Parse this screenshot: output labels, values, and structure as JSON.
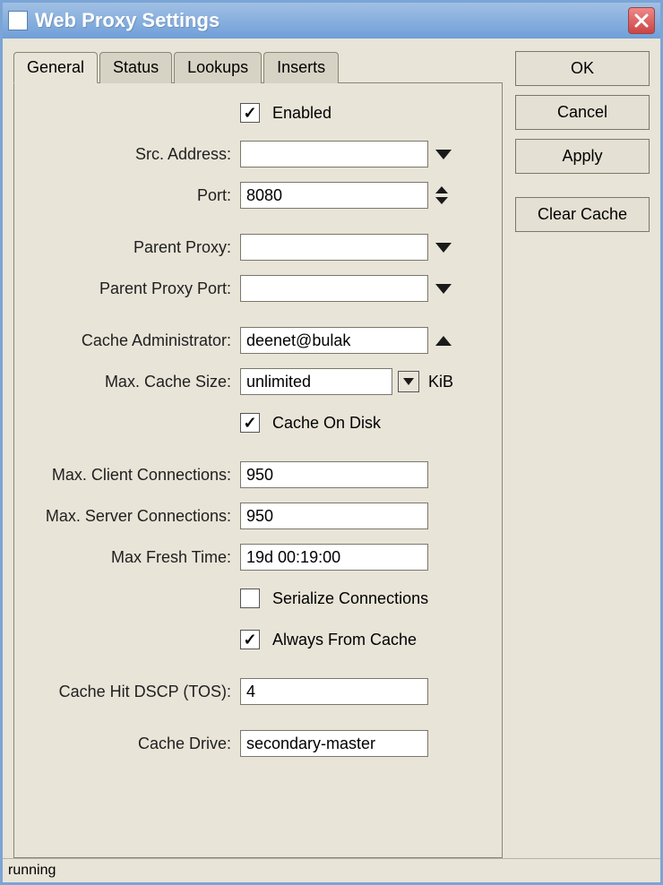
{
  "window": {
    "title": "Web Proxy Settings"
  },
  "tabs": {
    "general": "General",
    "status": "Status",
    "lookups": "Lookups",
    "inserts": "Inserts"
  },
  "labels": {
    "enabled": "Enabled",
    "src_address": "Src. Address:",
    "port": "Port:",
    "parent_proxy": "Parent Proxy:",
    "parent_proxy_port": "Parent Proxy Port:",
    "cache_admin": "Cache Administrator:",
    "max_cache_size": "Max. Cache Size:",
    "cache_on_disk": "Cache On Disk",
    "max_client_conn": "Max. Client Connections:",
    "max_server_conn": "Max. Server Connections:",
    "max_fresh_time": "Max Fresh Time:",
    "serialize_conn": "Serialize Connections",
    "always_from_cache": "Always From Cache",
    "cache_hit_dscp": "Cache Hit DSCP (TOS):",
    "cache_drive": "Cache Drive:",
    "kib": "KiB"
  },
  "values": {
    "enabled": true,
    "src_address": "",
    "port": "8080",
    "parent_proxy": "",
    "parent_proxy_port": "",
    "cache_admin": "deenet@bulak",
    "max_cache_size": "unlimited",
    "cache_on_disk": true,
    "max_client_conn": "950",
    "max_server_conn": "950",
    "max_fresh_time": "19d 00:19:00",
    "serialize_conn": false,
    "always_from_cache": true,
    "cache_hit_dscp": "4",
    "cache_drive": "secondary-master"
  },
  "buttons": {
    "ok": "OK",
    "cancel": "Cancel",
    "apply": "Apply",
    "clear_cache": "Clear Cache"
  },
  "status": "running"
}
